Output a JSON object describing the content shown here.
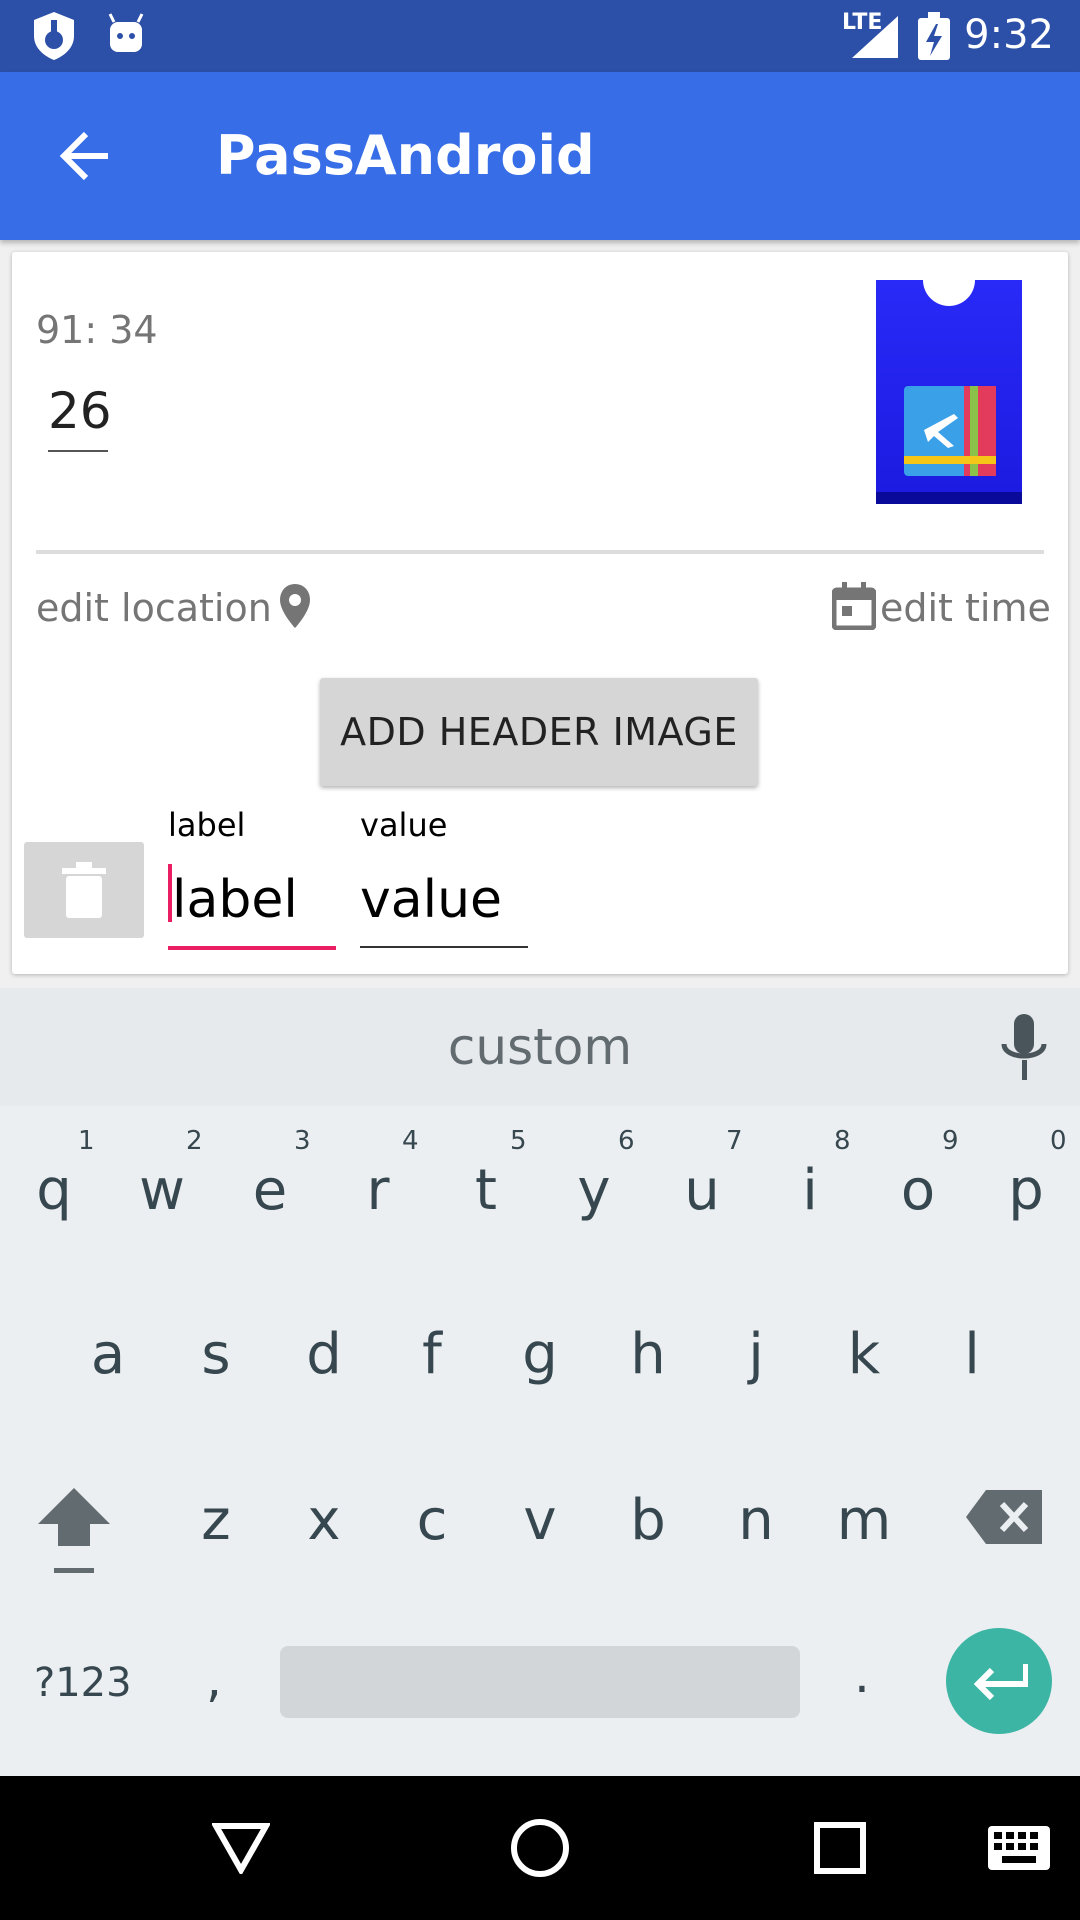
{
  "status_bar": {
    "time": "9:32",
    "network": "LTE"
  },
  "app_bar": {
    "title": "PassAndroid",
    "back_icon": "arrow-back-icon"
  },
  "card": {
    "time_text": "91: 34",
    "value_text": "26",
    "edit_location": "edit location",
    "edit_time": "edit time",
    "add_header_image": "ADD HEADER IMAGE",
    "field_label_caption": "label",
    "field_value_caption": "value",
    "field_label_text": "label",
    "field_value_text": "value"
  },
  "keyboard": {
    "suggestion": "custom",
    "row1": [
      "q",
      "w",
      "e",
      "r",
      "t",
      "y",
      "u",
      "i",
      "o",
      "p"
    ],
    "row1_hints": [
      "1",
      "2",
      "3",
      "4",
      "5",
      "6",
      "7",
      "8",
      "9",
      "0"
    ],
    "row2": [
      "a",
      "s",
      "d",
      "f",
      "g",
      "h",
      "j",
      "k",
      "l"
    ],
    "row3": [
      "z",
      "x",
      "c",
      "v",
      "b",
      "n",
      "m"
    ],
    "symbols_key": "?123",
    "comma_key": ",",
    "period_key": "."
  },
  "colors": {
    "status_bar": "#2c4fa8",
    "app_bar": "#376de7",
    "accent": "#e91e63",
    "enter_key": "#3db5a5"
  }
}
